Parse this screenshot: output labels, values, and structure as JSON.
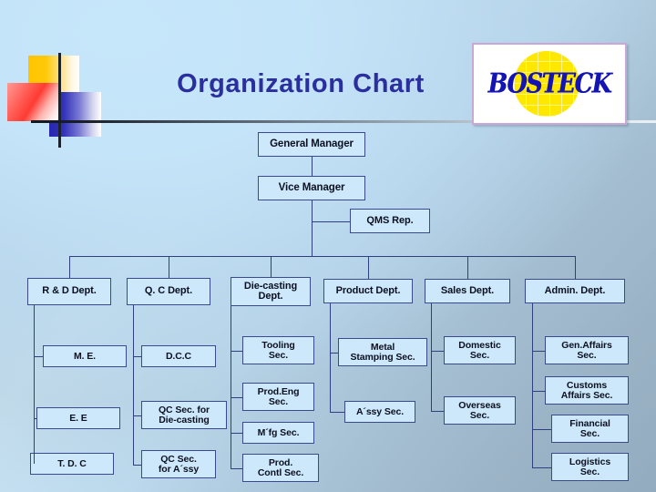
{
  "slide": {
    "title": "Organization Chart",
    "logo_text": "BOSTECK",
    "accent_title_color": "#2b2f9e",
    "box_fill_color": "#cde8fb",
    "box_border_color": "#3a4a8c",
    "logo_globe_color": "#ffe800",
    "logo_ink_color": "#1414b4"
  },
  "org": {
    "top": [
      {
        "id": "general-manager",
        "label": "General Manager"
      },
      {
        "id": "vice-manager",
        "label": "Vice Manager"
      },
      {
        "id": "qms-rep",
        "label": "QMS Rep."
      }
    ],
    "departments": [
      {
        "id": "rd-dept",
        "label": "R & D Dept.",
        "sections": [
          {
            "id": "me",
            "label": "M. E."
          },
          {
            "id": "ee",
            "label": "E. E"
          },
          {
            "id": "tdc",
            "label": "T. D. C"
          }
        ]
      },
      {
        "id": "qc-dept",
        "label": "Q. C Dept.",
        "sections": [
          {
            "id": "dcc",
            "label": "D.C.C"
          },
          {
            "id": "qc-sec-die-casting",
            "label": "QC Sec. for\nDie-casting"
          },
          {
            "id": "qc-sec-assy",
            "label": "QC Sec.\nfor A´ssy"
          }
        ]
      },
      {
        "id": "die-casting-dept",
        "label": "Die-casting\nDept.",
        "sections": [
          {
            "id": "tooling-sec",
            "label": "Tooling\nSec."
          },
          {
            "id": "prod-eng-sec",
            "label": "Prod.Eng\nSec."
          },
          {
            "id": "mfg-sec",
            "label": "M´fg Sec."
          },
          {
            "id": "prod-contl-sec",
            "label": "Prod.\nContl Sec."
          }
        ]
      },
      {
        "id": "product-dept",
        "label": "Product Dept.",
        "sections": [
          {
            "id": "metal-stamping-sec",
            "label": "Metal\nStamping Sec."
          },
          {
            "id": "assy-sec",
            "label": "A´ssy Sec."
          }
        ]
      },
      {
        "id": "sales-dept",
        "label": "Sales Dept.",
        "sections": [
          {
            "id": "domestic-sec",
            "label": "Domestic\nSec."
          },
          {
            "id": "overseas-sec",
            "label": "Overseas\nSec."
          }
        ]
      },
      {
        "id": "admin-dept",
        "label": "Admin.  Dept.",
        "sections": [
          {
            "id": "gen-affairs-sec",
            "label": "Gen.Affairs\nSec."
          },
          {
            "id": "customs-affairs-sec",
            "label": "Customs\nAffairs Sec."
          },
          {
            "id": "financial-sec",
            "label": "Financial\nSec."
          },
          {
            "id": "logistics-sec",
            "label": "Logistics\nSec."
          }
        ]
      }
    ]
  }
}
